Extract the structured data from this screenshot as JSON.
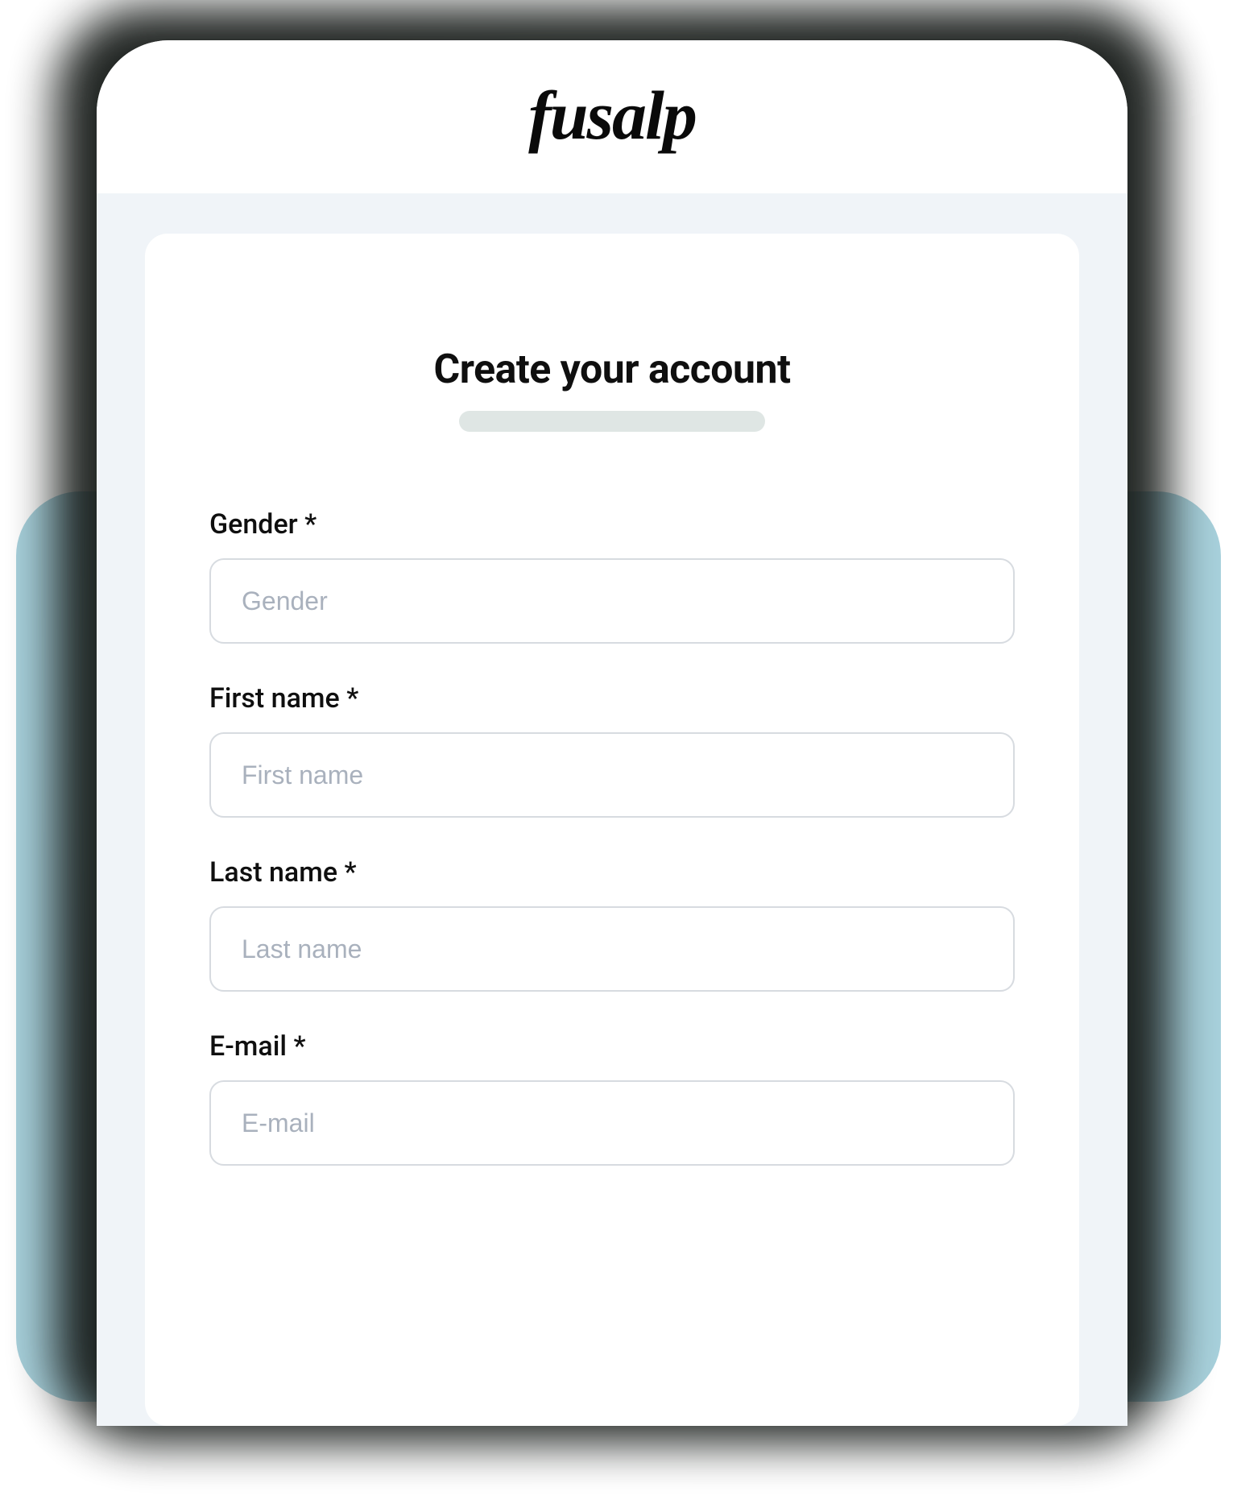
{
  "brand": {
    "name": "fusalp"
  },
  "form": {
    "title": "Create your account",
    "fields": {
      "gender": {
        "label": "Gender *",
        "placeholder": "Gender",
        "value": ""
      },
      "first_name": {
        "label": "First name *",
        "placeholder": "First name",
        "value": ""
      },
      "last_name": {
        "label": "Last name *",
        "placeholder": "Last name",
        "value": ""
      },
      "email": {
        "label": "E-mail *",
        "placeholder": "E-mail",
        "value": ""
      }
    }
  }
}
